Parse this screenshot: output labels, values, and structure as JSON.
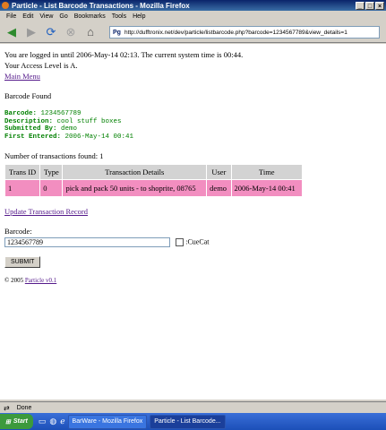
{
  "window": {
    "title": "Particle - List Barcode Transactions - Mozilla Firefox"
  },
  "menu": [
    "File",
    "Edit",
    "View",
    "Go",
    "Bookmarks",
    "Tools",
    "Help"
  ],
  "url": "http://dufftronix.net/dev/particle/listbarcode.php?barcode=1234567789&view_details=1",
  "page": {
    "login_line": "You are logged in until 2006-May-14 02:13. The current system time is 00:44.",
    "access_line": "Your Access Level is A.",
    "main_menu": "Main Menu",
    "barcode_found": "Barcode Found",
    "details": {
      "barcode_label": "Barcode:",
      "barcode_value": "1234567789",
      "description_label": "Description:",
      "description_value": "cool stuff boxes",
      "submitted_label": "Submitted By:",
      "submitted_value": "demo",
      "first_entered_label": "First Entered:",
      "first_entered_value": "2006-May-14 00:41"
    },
    "tx_count": "Number of transactions found: 1",
    "table": {
      "headers": [
        "Trans ID",
        "Type",
        "Transaction Details",
        "User",
        "Time"
      ],
      "rows": [
        [
          "1",
          "0",
          "pick and pack 50 units - to shoprite, 08765",
          "demo",
          "2006-May-14 00:41"
        ]
      ]
    },
    "update_link": "Update Transaction Record",
    "barcode_field_label": "Barcode:",
    "barcode_field_value": "1234567789",
    "cuecat_label": ":CueCat",
    "submit_label": "SUBMIT",
    "footer_prefix": "© 2005",
    "footer_link": "Particle v0.1"
  },
  "status": "Done",
  "taskbar": {
    "start": "Start",
    "tasks": [
      "BarWare - Mozilla Firefox",
      "Particle - List Barcode..."
    ]
  }
}
